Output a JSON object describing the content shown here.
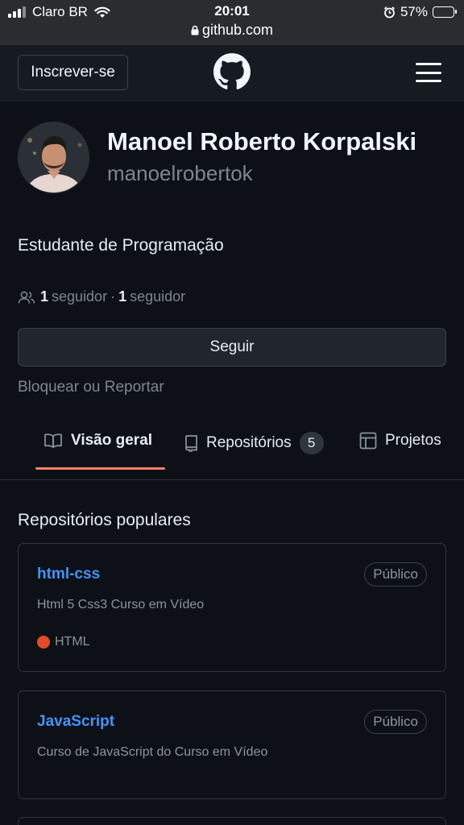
{
  "status_bar": {
    "carrier": "Claro BR",
    "time": "20:01",
    "url": "github.com",
    "battery": "57%",
    "battery_level": 0.57,
    "icons": [
      "signal-icon",
      "wifi-icon",
      "lock-icon",
      "alarm-icon",
      "battery-icon"
    ]
  },
  "header": {
    "signup_label": "Inscrever-se",
    "logo_icon": "github-logo-icon",
    "menu_icon": "hamburger-menu-icon"
  },
  "profile": {
    "full_name": "Manoel Roberto Korpalski",
    "username": "manoelrobertok",
    "bio": "Estudante de Programação",
    "followers_count": "1",
    "followers_label": "seguidor",
    "separator": "·",
    "following_count": "1",
    "following_label": "seguidor",
    "follow_button": "Seguir",
    "block_link": "Bloquear ou Reportar"
  },
  "tabs": [
    {
      "label": "Visão geral",
      "icon": "book-icon",
      "active": true
    },
    {
      "label": "Repositórios",
      "icon": "repo-icon",
      "counter": "5"
    },
    {
      "label": "Projetos",
      "icon": "table-icon"
    }
  ],
  "popular": {
    "title": "Repositórios populares",
    "repos": [
      {
        "name": "html-css",
        "visibility": "Público",
        "description": "Html 5 Css3 Curso em Vídeo",
        "language": "HTML",
        "language_color": "#e34c26"
      },
      {
        "name": "JavaScript",
        "visibility": "Público",
        "description": "Curso de JavaScript do Curso em Vídeo"
      }
    ]
  }
}
